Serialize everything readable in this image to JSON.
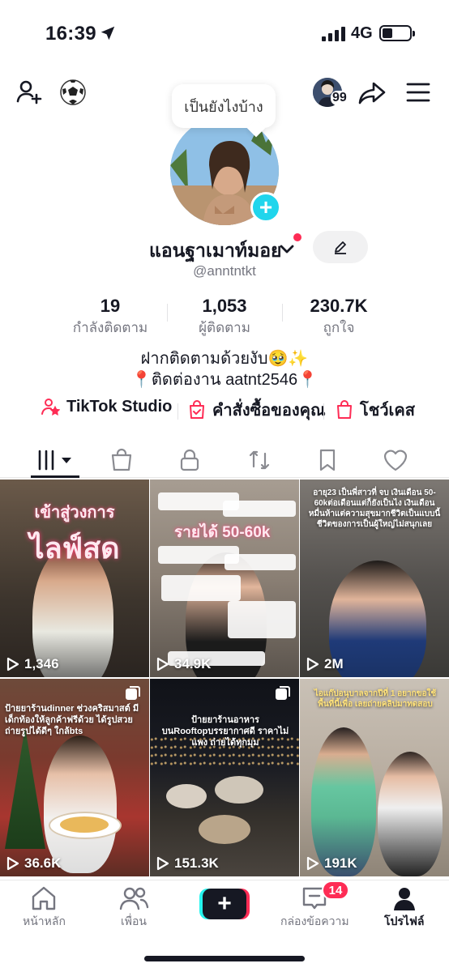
{
  "status_bar": {
    "time": "16:39",
    "network": "4G"
  },
  "top_nav": {
    "viewer_count": "99"
  },
  "profile": {
    "bubble_text": "เป็นยังไงบ้าง",
    "display_name": "แอนฐาเมาท์มอย",
    "handle": "@anntntkt",
    "stats": [
      {
        "value": "19",
        "label": "กำลังติดตาม"
      },
      {
        "value": "1,053",
        "label": "ผู้ติดตาม"
      },
      {
        "value": "230.7K",
        "label": "ถูกใจ"
      }
    ],
    "bio_line1": "ฝากติดตามด้วยงับ🥹✨",
    "bio_line2": "📍ติดต่องาน aatnt2546📍"
  },
  "tools": {
    "studio": "TikTok Studio",
    "orders": "คำสั่งซื้อของคุณ",
    "showcase": "โชว์เคส"
  },
  "videos": [
    {
      "views": "1,346",
      "caption": "เข้าสู่วงการ",
      "caption2": "ไลฟ์สด"
    },
    {
      "views": "34.9K",
      "caption": "รายได้ 50-60k"
    },
    {
      "views": "2M",
      "caption": "อายุ23 เป็นพี่สาวที่ จบ เงินเดือน 50-60kต่อเดือนแต่ก็ยังเป็นไง เงินเดือนหมื่นห้าแต่ความสุขมากชีวิตเป็นแบบนี้ ชีวิตของการเป็นผู้ใหญ่ไม่สนุกเลย"
    },
    {
      "views": "36.6K",
      "caption": "ป้ายยาร้านdinner ช่วงคริสมาสต์ มีเด็กท้องให้ลูกค้าฟรีด้วย ได้รูปสวยถ่ายรูปได้ดีๆ ใกล้bts"
    },
    {
      "views": "151.3K",
      "caption": "ป้ายยาร้านอาหารบนRooftopบรรยากาศดี ราคาไม่แพง ถ่ายได้ทุกมุม"
    },
    {
      "views": "191K",
      "caption": "ไอแก๊ปอนุบาลจากปีที่ 1 อยากขอใช้พื้นที่นี้เพื่อ เลยถ่ายคลิปมาทดสอบ"
    }
  ],
  "bottom_nav": {
    "home": "หน้าหลัก",
    "friends": "เพื่อน",
    "inbox": "กล่องข้อความ",
    "inbox_badge": "14",
    "profile": "โปรไฟล์"
  }
}
